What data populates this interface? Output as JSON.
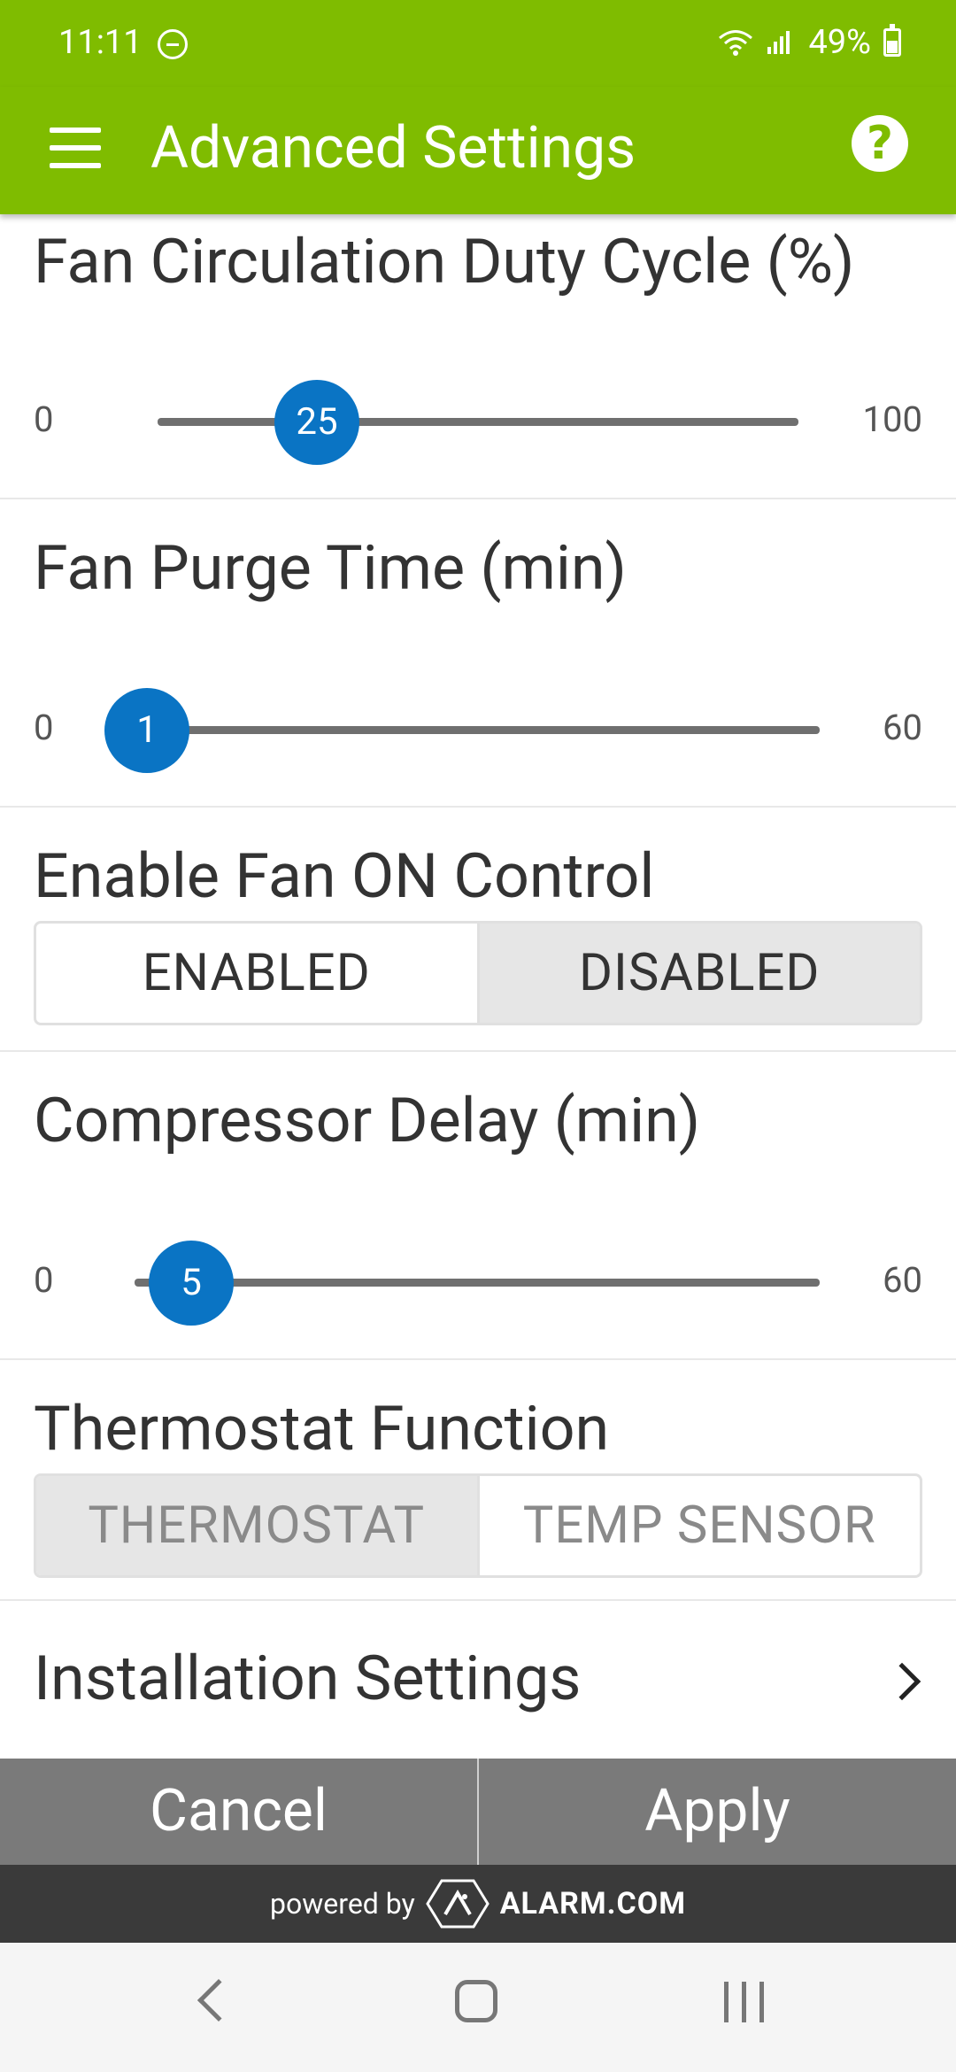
{
  "status_bar": {
    "time": "11:11",
    "battery": "49%"
  },
  "app_bar": {
    "title": "Advanced Settings",
    "help_symbol": "?"
  },
  "fan_circulation": {
    "title": "Fan Circulation Duty Cycle (%)",
    "min": "0",
    "max": "100",
    "value": "25"
  },
  "fan_purge": {
    "title": "Fan Purge Time (min)",
    "min": "0",
    "max": "60",
    "value": "1"
  },
  "fan_on_control": {
    "title": "Enable Fan ON Control",
    "enabled_label": "ENABLED",
    "disabled_label": "DISABLED",
    "selected": "DISABLED"
  },
  "compressor_delay": {
    "title": "Compressor Delay (min)",
    "min": "0",
    "max": "60",
    "value": "5"
  },
  "thermostat_function": {
    "title": "Thermostat Function",
    "thermostat_label": "THERMOSTAT",
    "temp_sensor_label": "TEMP SENSOR",
    "selected": "THERMOSTAT"
  },
  "installation": {
    "title": "Installation Settings"
  },
  "actions": {
    "cancel": "Cancel",
    "apply": "Apply"
  },
  "footer": {
    "powered_by": "powered by",
    "brand": "ALARM.COM"
  },
  "icons": [
    "menu-icon",
    "help-icon",
    "chevron-right-icon",
    "back-icon",
    "home-icon",
    "recents-icon",
    "wifi-icon",
    "signal-icon",
    "battery-icon",
    "do-not-disturb-icon"
  ],
  "colors": {
    "app_bar": "#7fbc00",
    "slider_thumb": "#0a74c4",
    "action_bar": "#7a7a7a",
    "footer": "#3a3a3a"
  }
}
